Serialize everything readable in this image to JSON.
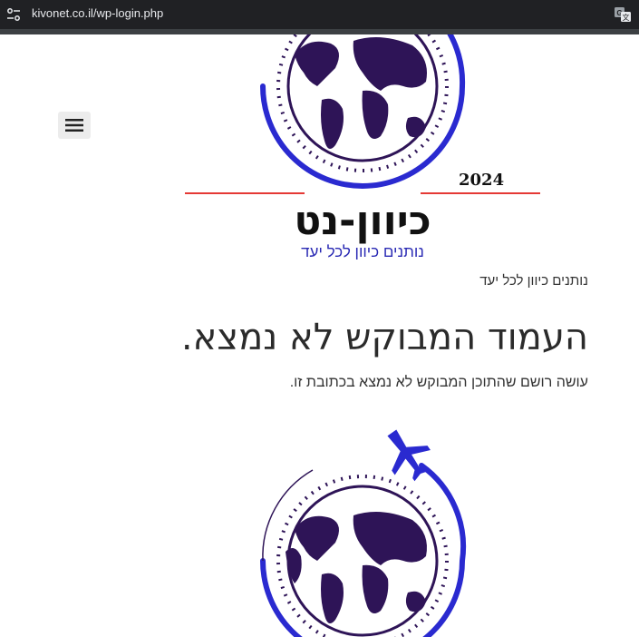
{
  "browser": {
    "url": "kivonet.co.il/wp-login.php",
    "site_info_icon": "tune-icon",
    "translate_icon": "translate-icon"
  },
  "header": {
    "year": "2024",
    "brand_name": "כיוון-נט",
    "tagline": "נותנים כיוון לכל יעד",
    "menu_icon": "hamburger-menu-icon",
    "colors": {
      "globe_land": "#2e1457",
      "ring_blue": "#2a2ad0",
      "accent_red": "#e53935",
      "tagline_blue": "#2a2ab4"
    }
  },
  "main": {
    "site_description": "נותנים כיוון לכל יעד",
    "error_title": "העמוד המבוקש לא נמצא.",
    "error_message": "עושה רושם שהתוכן המבוקש לא נמצא בכתובת זו."
  }
}
